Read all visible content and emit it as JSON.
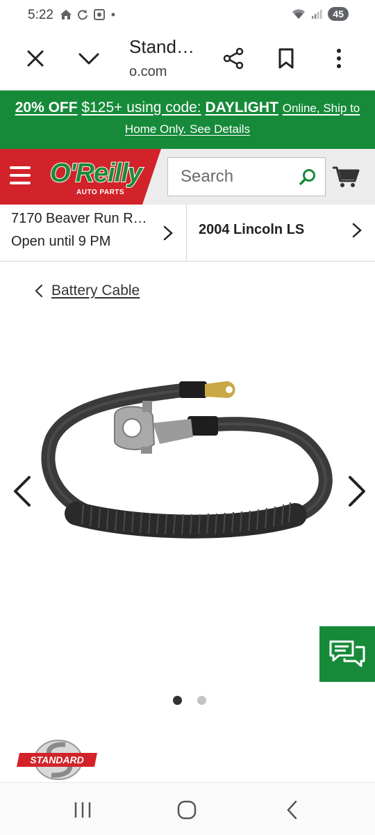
{
  "status_bar": {
    "time": "5:22",
    "battery": "45",
    "icons_left": [
      "home-icon",
      "sync-icon",
      "screenshot-icon",
      "dot-icon"
    ],
    "icons_right": [
      "wifi-icon",
      "signal-icon",
      "battery-icon"
    ]
  },
  "browser": {
    "title": "Stand…",
    "url": "o.com",
    "icons": [
      "close-icon",
      "chevron-down-icon",
      "share-icon",
      "bookmark-icon",
      "more-vert-icon"
    ]
  },
  "promo": {
    "discount": "20% OFF",
    "threshold": "$125+ using code:",
    "code": "DAYLIGHT",
    "conditions_part1": "Online, Ship to",
    "conditions_part2": "Home Only. See Details"
  },
  "header": {
    "logo_text": "O'Reilly",
    "logo_sub": "AUTO PARTS",
    "search_placeholder": "Search",
    "accent_red": "#d2232a",
    "accent_green": "#168a39"
  },
  "store": {
    "name": "7170 Beaver Run R…",
    "hours": "Open until 9 PM"
  },
  "vehicle": {
    "name": "2004 Lincoln LS"
  },
  "breadcrumb": {
    "label": "Battery Cable"
  },
  "carousel": {
    "total": 2,
    "active": 1
  },
  "brand": {
    "name": "STANDARD"
  }
}
